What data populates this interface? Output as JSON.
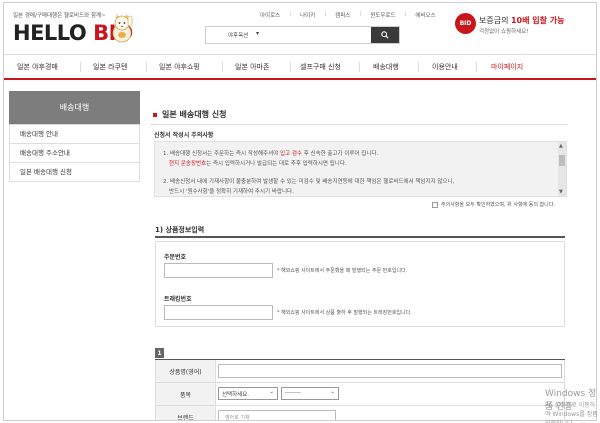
{
  "header": {
    "tagline": "일본 경매/구매대행은 헬로비드와 함께~",
    "logo_part1": "HELLO",
    "logo_part2": "BID",
    "top_links": [
      "아이로스",
      "나이키",
      "캠퍼스",
      "윈도우로드",
      "에비오스"
    ],
    "search": {
      "category": "야후옥션",
      "category_chevron": "▾"
    },
    "badge_text": "BID",
    "promo_pre": "보증금의 ",
    "promo_highlight": "10배 입찰 가능",
    "promo_sub": "걱정없이 쇼핑하세요!"
  },
  "nav": [
    "일본 야후경매",
    "일본 라쿠텐",
    "일본 야후쇼핑",
    "일본 아마존",
    "셀프구매 신청",
    "배송대행",
    "이용안내",
    "마이페이지"
  ],
  "sidebar": {
    "title": "배송대행",
    "items": [
      "배송대행 안내",
      "배송대행 주소안내",
      "일본 배송대행 신청"
    ]
  },
  "main": {
    "title": "일본 배송대행 신청",
    "notice_title": "신청서 작성시 주의사항",
    "notice_1a": "1. 배송대행 신청서는 주문하는 즉시 작성해주셔야 ",
    "notice_1b": "입고 검수",
    "notice_1c": " 후 신속한 출고가 이루어 집니다.",
    "notice_2a": "현지 운송장번호",
    "notice_2b": "는 즉시 입력하시거나 발급되는 대로 추후 입력하시면 됩니다.",
    "notice_3": "2. 배송신청서 내에 기재사항이 불충분하여 발생할 수 있는 미검수 및 배송지연등에 대한 책임은 헬로비드에서 책임지지 않으니,",
    "notice_4": "반드시 '원수사항'을 정확히 기재하여 주시기 바랍니다.",
    "agree_label": "주의사항을 모두 확인하였으며, 위 사항에 동의 합니다.",
    "section1_title": "1) 상품정보입력",
    "order_no_label": "주문번호",
    "order_no_hint": "* 해외쇼핑 사이트에서 주문했을 때 발행되는 주문 번호입니다.",
    "tracking_label": "트래킹번호",
    "tracking_hint": "* 해외쇼핑 사이트에서 상품 출하 후 발행되는 트래킹번호입니다.",
    "section2_num": "1",
    "product_name_label": "상품명(영어)",
    "category_label": "품목",
    "category_select1": "선택하세요.",
    "category_select2": "--------",
    "brand_label": "브랜드",
    "brand_placeholder": "영어로 기재"
  },
  "watermark": {
    "line1": "Windows 정품 인증",
    "line2": "PC 설정으로 이동하여 Windows를 정품 인증합니다."
  },
  "colors": {
    "accent": "#c8161d",
    "sidebar_head": "#7d7d7d"
  }
}
